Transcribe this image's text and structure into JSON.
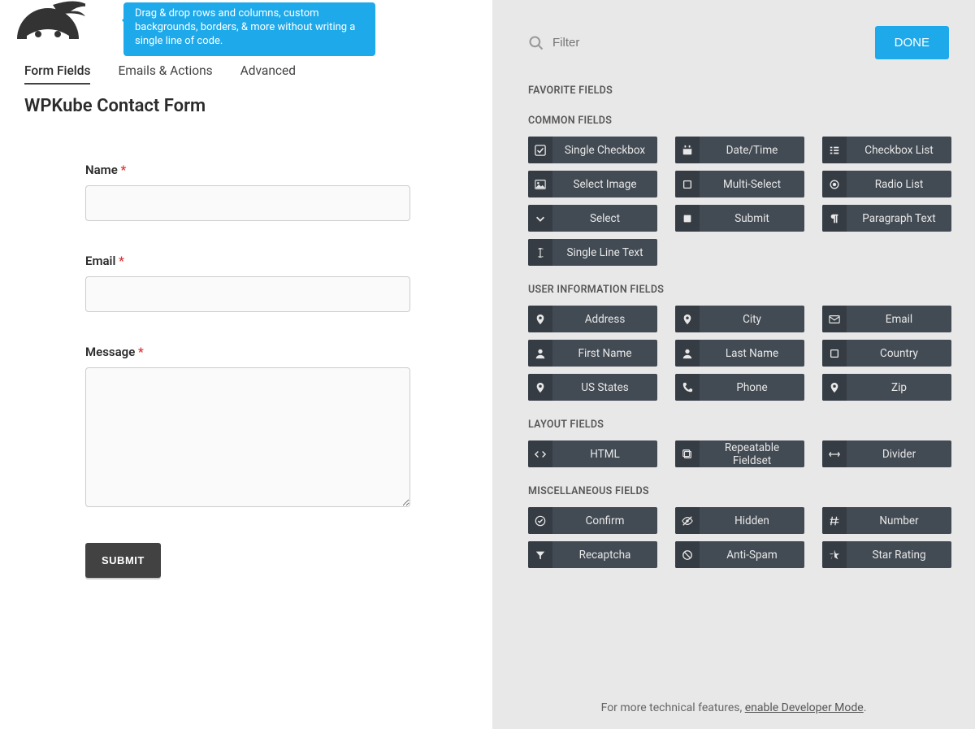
{
  "tip_text": "Drag & drop rows and columns, custom backgrounds, borders, & more without writing a single line of code.",
  "tabs": {
    "form_fields": "Form Fields",
    "emails_actions": "Emails & Actions",
    "advanced": "Advanced"
  },
  "form_title": "WPKube Contact Form",
  "fields": {
    "name": {
      "label": "Name",
      "required": "*"
    },
    "email": {
      "label": "Email",
      "required": "*"
    },
    "message": {
      "label": "Message",
      "required": "*"
    }
  },
  "submit_label": "SUBMIT",
  "filter_placeholder": "Filter",
  "done_label": "DONE",
  "sections": {
    "favorite": "FAVORITE FIELDS",
    "common": "COMMON FIELDS",
    "user_info": "USER INFORMATION FIELDS",
    "layout": "LAYOUT FIELDS",
    "misc": "MISCELLANEOUS FIELDS"
  },
  "tiles": {
    "single_checkbox": "Single Checkbox",
    "date_time": "Date/Time",
    "checkbox_list": "Checkbox List",
    "select_image": "Select Image",
    "multi_select": "Multi-Select",
    "radio_list": "Radio List",
    "select": "Select",
    "submit": "Submit",
    "paragraph_text": "Paragraph Text",
    "single_line_text": "Single Line Text",
    "address": "Address",
    "city": "City",
    "email": "Email",
    "first_name": "First Name",
    "last_name": "Last Name",
    "country": "Country",
    "us_states": "US States",
    "phone": "Phone",
    "zip": "Zip",
    "html": "HTML",
    "repeatable_fieldset": "Repeatable Fieldset",
    "divider": "Divider",
    "confirm": "Confirm",
    "hidden": "Hidden",
    "number": "Number",
    "recaptcha": "Recaptcha",
    "anti_spam": "Anti-Spam",
    "star_rating": "Star Rating"
  },
  "footer": {
    "prefix": "For more technical features, ",
    "link": "enable Developer Mode",
    "suffix": "."
  }
}
